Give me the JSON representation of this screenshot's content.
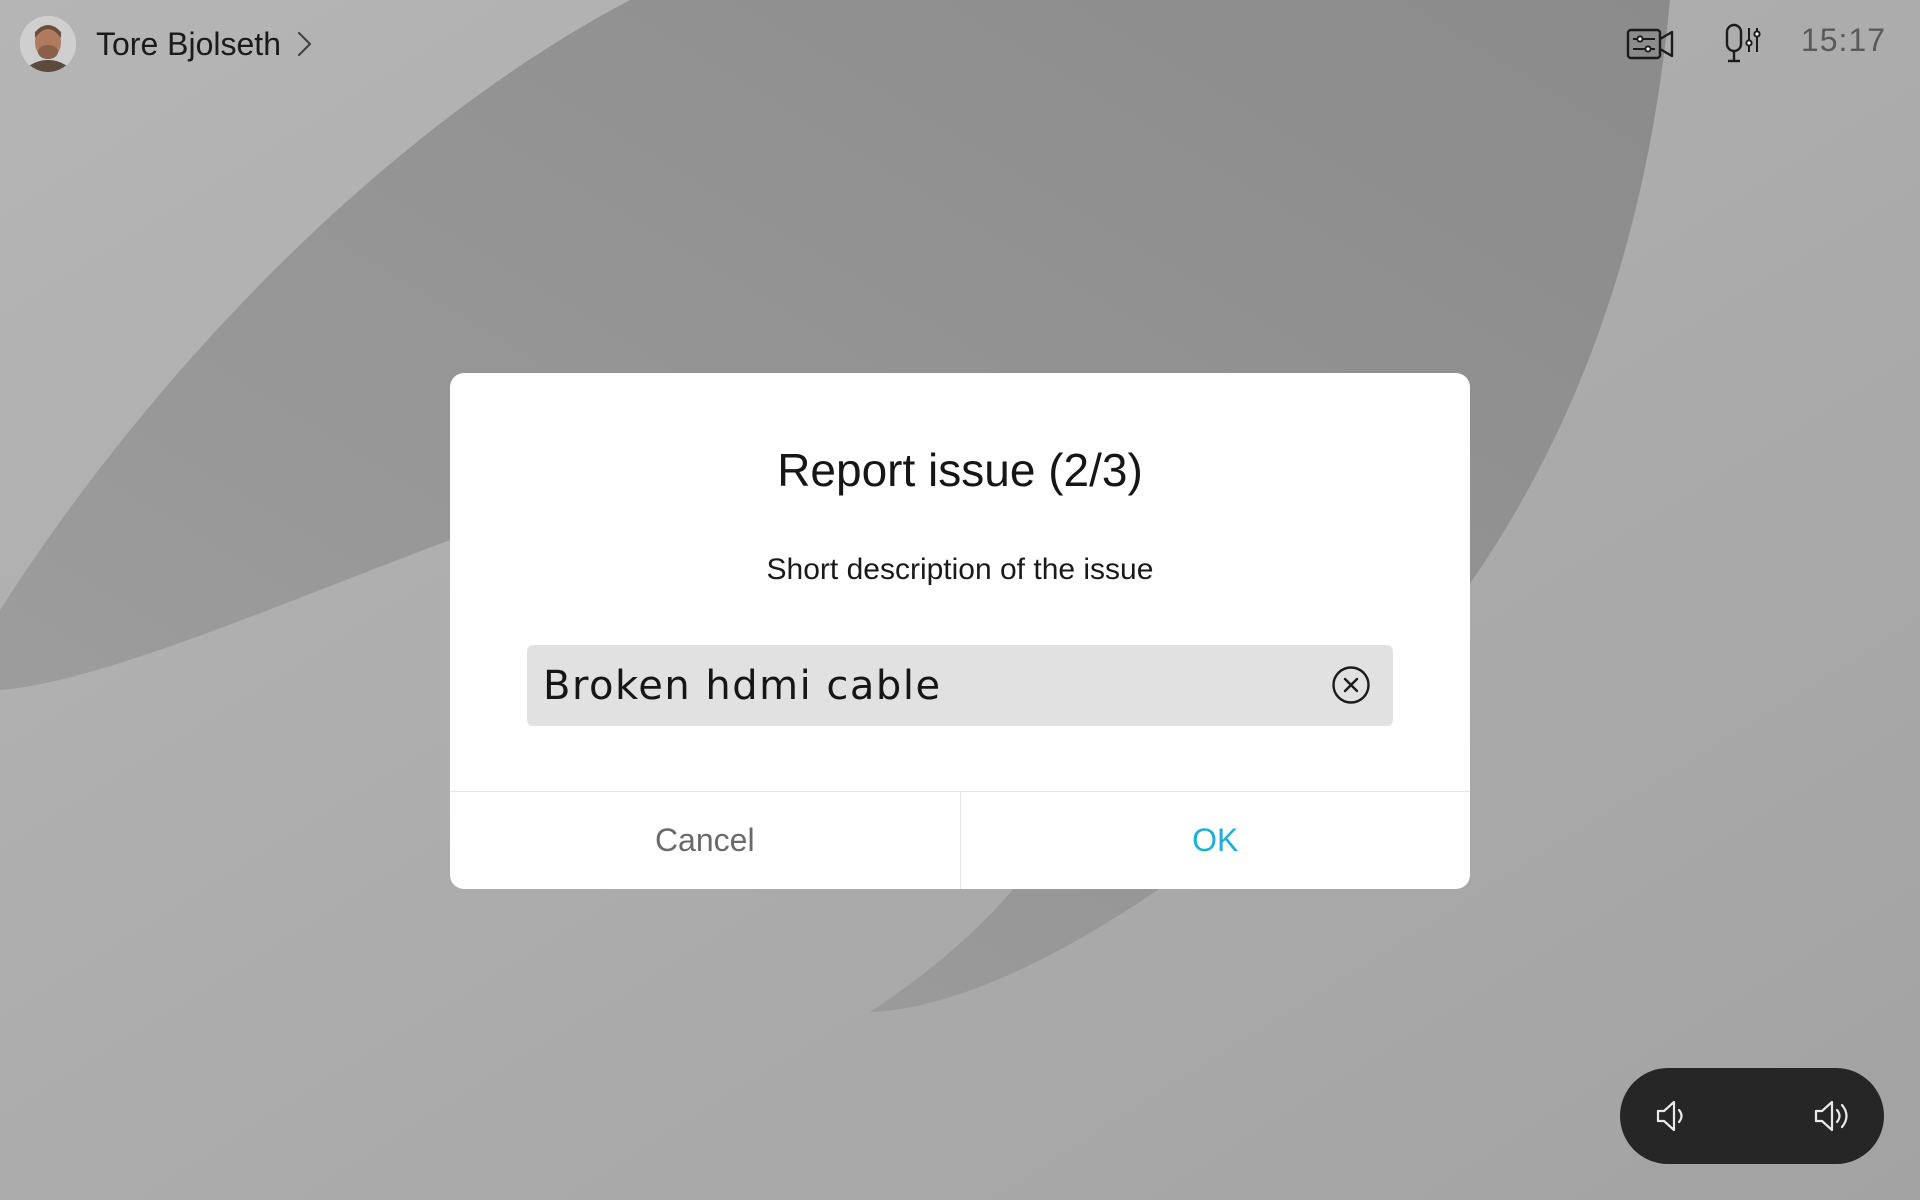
{
  "user": {
    "name": "Tore Bjolseth"
  },
  "status": {
    "time": "15:17"
  },
  "dialog": {
    "title": "Report issue (2/3)",
    "subtitle": "Short description of the issue",
    "input_value": "Broken hdmi cable",
    "cancel_label": "Cancel",
    "ok_label": "OK"
  },
  "icons": {
    "camera_settings": "camera-controls-icon",
    "mic_settings": "microphone-controls-icon",
    "clear": "clear-circle-icon",
    "volume_down": "volume-down-icon",
    "volume_up": "volume-up-icon"
  },
  "colors": {
    "accent": "#1ab0d8",
    "dialog_bg": "#ffffff",
    "input_bg": "#e1e1e1",
    "volume_bg": "#262626"
  }
}
